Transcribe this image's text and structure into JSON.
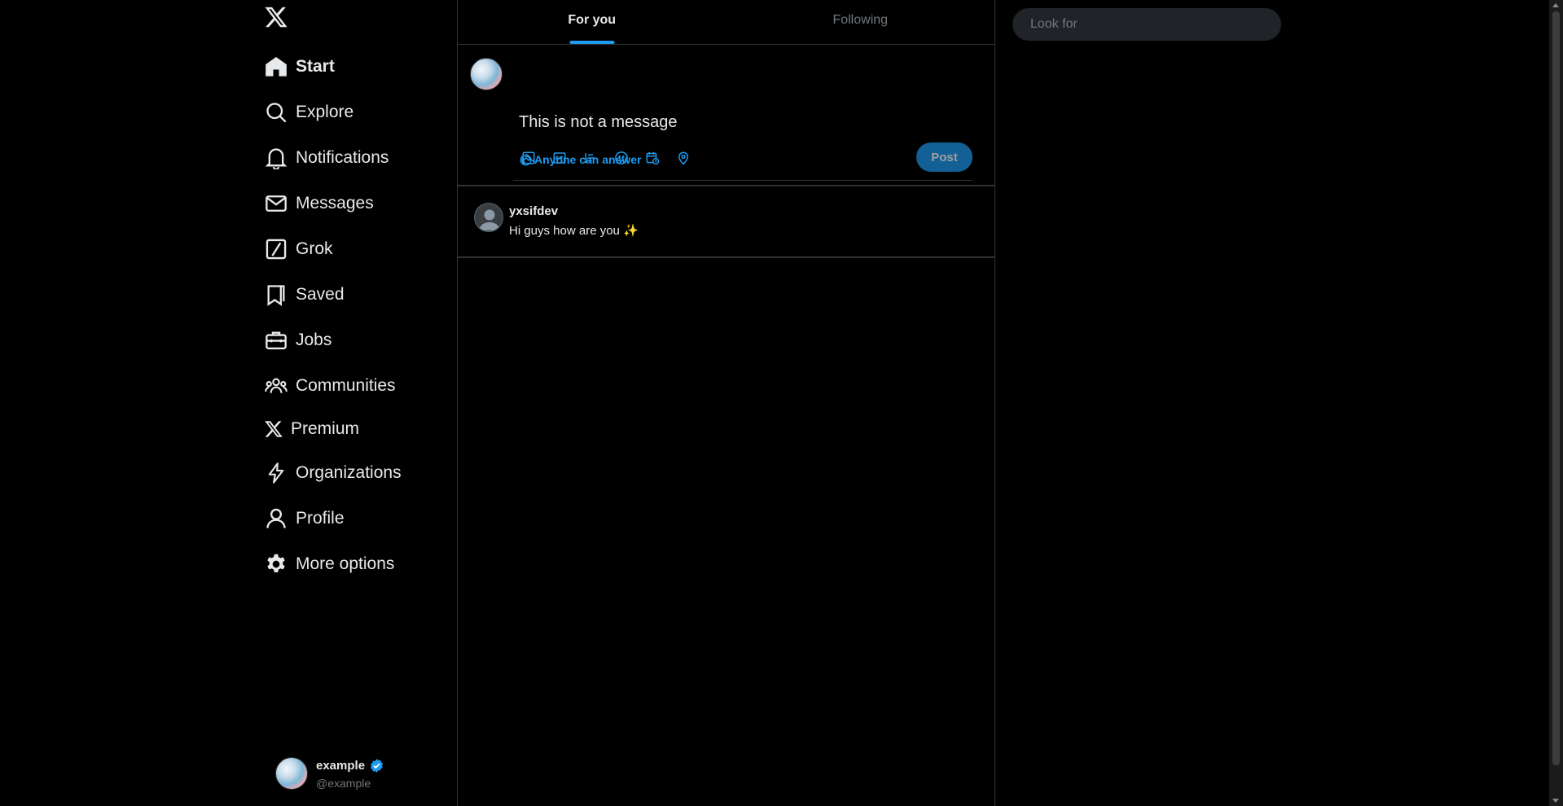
{
  "sidebar": {
    "logo_icon": "x-logo-icon",
    "items": [
      {
        "label": "Start",
        "icon": "home-icon",
        "active": true
      },
      {
        "label": "Explore",
        "icon": "search-icon"
      },
      {
        "label": "Notifications",
        "icon": "bell-icon"
      },
      {
        "label": "Messages",
        "icon": "envelope-icon"
      },
      {
        "label": "Grok",
        "icon": "grok-icon"
      },
      {
        "label": "Saved",
        "icon": "bookmark-icon"
      },
      {
        "label": "Jobs",
        "icon": "briefcase-icon"
      },
      {
        "label": "Communities",
        "icon": "people-icon"
      },
      {
        "label": "Premium",
        "icon": "x-logo-icon"
      },
      {
        "label": "Organizations",
        "icon": "lightning-icon"
      },
      {
        "label": "Profile",
        "icon": "person-icon"
      },
      {
        "label": "More options",
        "icon": "gear-icon"
      }
    ],
    "account": {
      "name": "example",
      "handle": "@example",
      "verified": true
    }
  },
  "main": {
    "tabs": [
      {
        "label": "For you",
        "active": true
      },
      {
        "label": "Following",
        "active": false
      }
    ],
    "composer": {
      "value": "This is not a message",
      "reply_setting": "Anyone can answer",
      "tools": [
        "image-icon",
        "gif-icon",
        "poll-icon",
        "emoji-icon",
        "schedule-icon",
        "location-icon"
      ],
      "post_label": "Post"
    },
    "posts": [
      {
        "author": "yxsifdev",
        "text": "Hi guys how are you ✨"
      }
    ]
  },
  "right": {
    "search": {
      "placeholder": "Look for"
    }
  },
  "colors": {
    "accent": "#1d9bf0",
    "background": "#000000",
    "border": "#2f3336",
    "muted": "#71767b"
  }
}
